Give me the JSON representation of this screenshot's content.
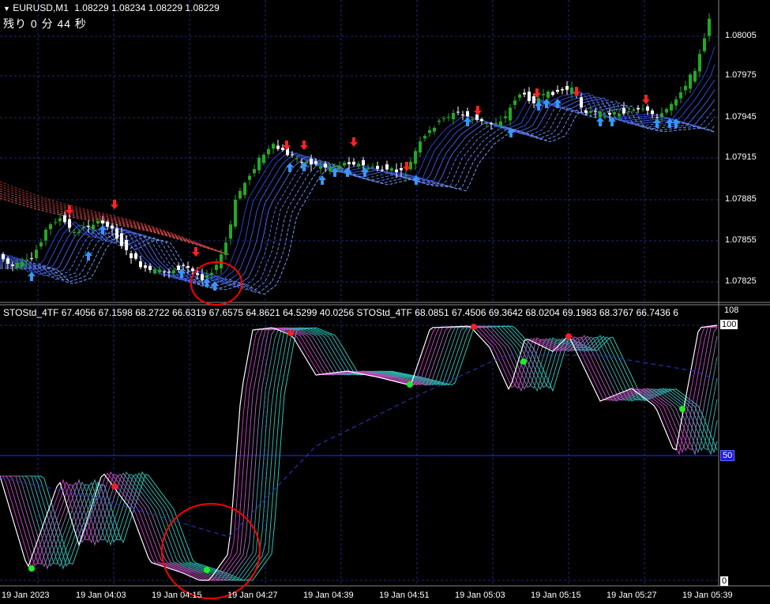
{
  "header": {
    "symbol": "EURUSD,M1",
    "ohlc": "1.08229 1.08234 1.08229 1.08229",
    "timer": "残り 0 分 44 秒"
  },
  "price_axis": [
    "1.08005",
    "1.07975",
    "1.07945",
    "1.07915",
    "1.07885",
    "1.07855",
    "1.07825"
  ],
  "indicator": {
    "header": "STOStd_4TF 67.4056 67.1598 68.2722 66.6319 67.6575 64.8621 64.5299 40.0256  STOStd_4TF 68.0851 67.4506 69.3642 68.0204 69.1983 68.3767 66.7436 6",
    "scale_top": "108",
    "level_top": "100",
    "level_mid": "50",
    "level_bottom": "0"
  },
  "time_axis": [
    "19 Jan 2023",
    "19 Jan 04:03",
    "19 Jan 04:15",
    "19 Jan 04:27",
    "19 Jan 04:39",
    "19 Jan 04:51",
    "19 Jan 05:03",
    "19 Jan 05:15",
    "19 Jan 05:27",
    "19 Jan 05:39"
  ],
  "colors": {
    "background": "#000000",
    "grid": "#1a2a7a",
    "bull": "#22aa22",
    "bear": "#ffffff",
    "arrow_up": "#3399ff",
    "arrow_down": "#ff2222",
    "circle": "#ff0000"
  },
  "icons": [
    "dropdown-triangle-icon",
    "buy-arrow-icon",
    "sell-arrow-icon"
  ]
}
